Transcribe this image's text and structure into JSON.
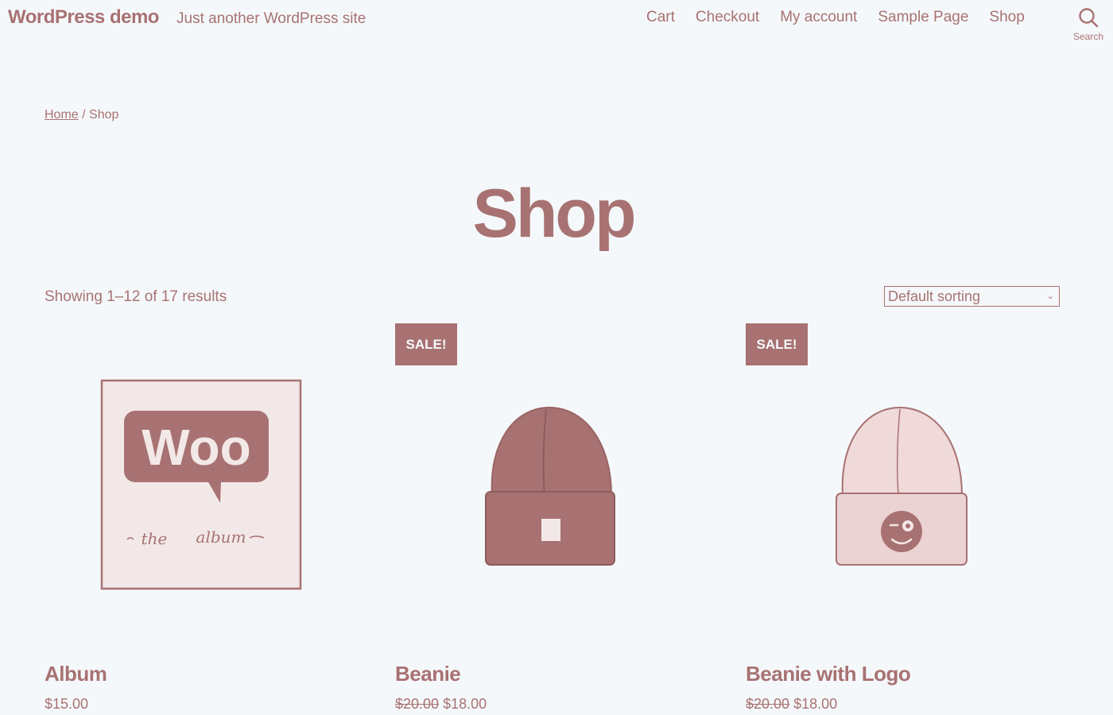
{
  "site": {
    "title": "WordPress demo",
    "tagline": "Just another WordPress site"
  },
  "nav": {
    "items": [
      "Cart",
      "Checkout",
      "My account",
      "Sample Page",
      "Shop"
    ]
  },
  "search": {
    "label": "Search"
  },
  "breadcrumb": {
    "home": "Home",
    "separator": " / ",
    "current": "Shop"
  },
  "page": {
    "title": "Shop"
  },
  "results": {
    "count_text": "Showing 1–12 of 17 results"
  },
  "sorting": {
    "selected": "Default sorting"
  },
  "products": [
    {
      "name": "Album",
      "regular_price": "",
      "price": "$15.00",
      "badge": ""
    },
    {
      "name": "Beanie",
      "regular_price": "$20.00",
      "price": "$18.00",
      "badge": "SALE!"
    },
    {
      "name": "Beanie with Logo",
      "regular_price": "$20.00",
      "price": "$18.00",
      "badge": "SALE!"
    }
  ],
  "album_art": {
    "logo_text": "Woo",
    "caption_left": "the",
    "caption_right": "album"
  },
  "colors": {
    "accent": "#a87272",
    "background": "#f5f8fa"
  }
}
